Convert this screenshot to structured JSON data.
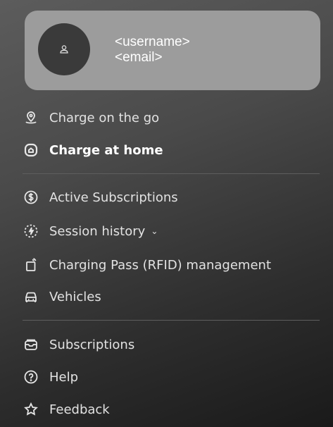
{
  "profile": {
    "username": "<username>",
    "email": "<email>"
  },
  "menu_primary": [
    {
      "label": "Charge on the go",
      "icon": "map-pin-icon",
      "active": false
    },
    {
      "label": "Charge at home",
      "icon": "home-charger-icon",
      "active": true
    }
  ],
  "menu_account": [
    {
      "label": "Active Subscriptions",
      "icon": "dollar-icon"
    },
    {
      "label": "Session history",
      "icon": "bolt-circle-icon",
      "chevron": "⌄"
    },
    {
      "label": "Charging Pass (RFID) management",
      "icon": "rfid-card-icon"
    },
    {
      "label": "Vehicles",
      "icon": "car-icon"
    }
  ],
  "menu_support": [
    {
      "label": "Subscriptions",
      "icon": "subscription-icon"
    },
    {
      "label": "Help",
      "icon": "help-icon"
    },
    {
      "label": "Feedback",
      "icon": "star-icon"
    }
  ]
}
